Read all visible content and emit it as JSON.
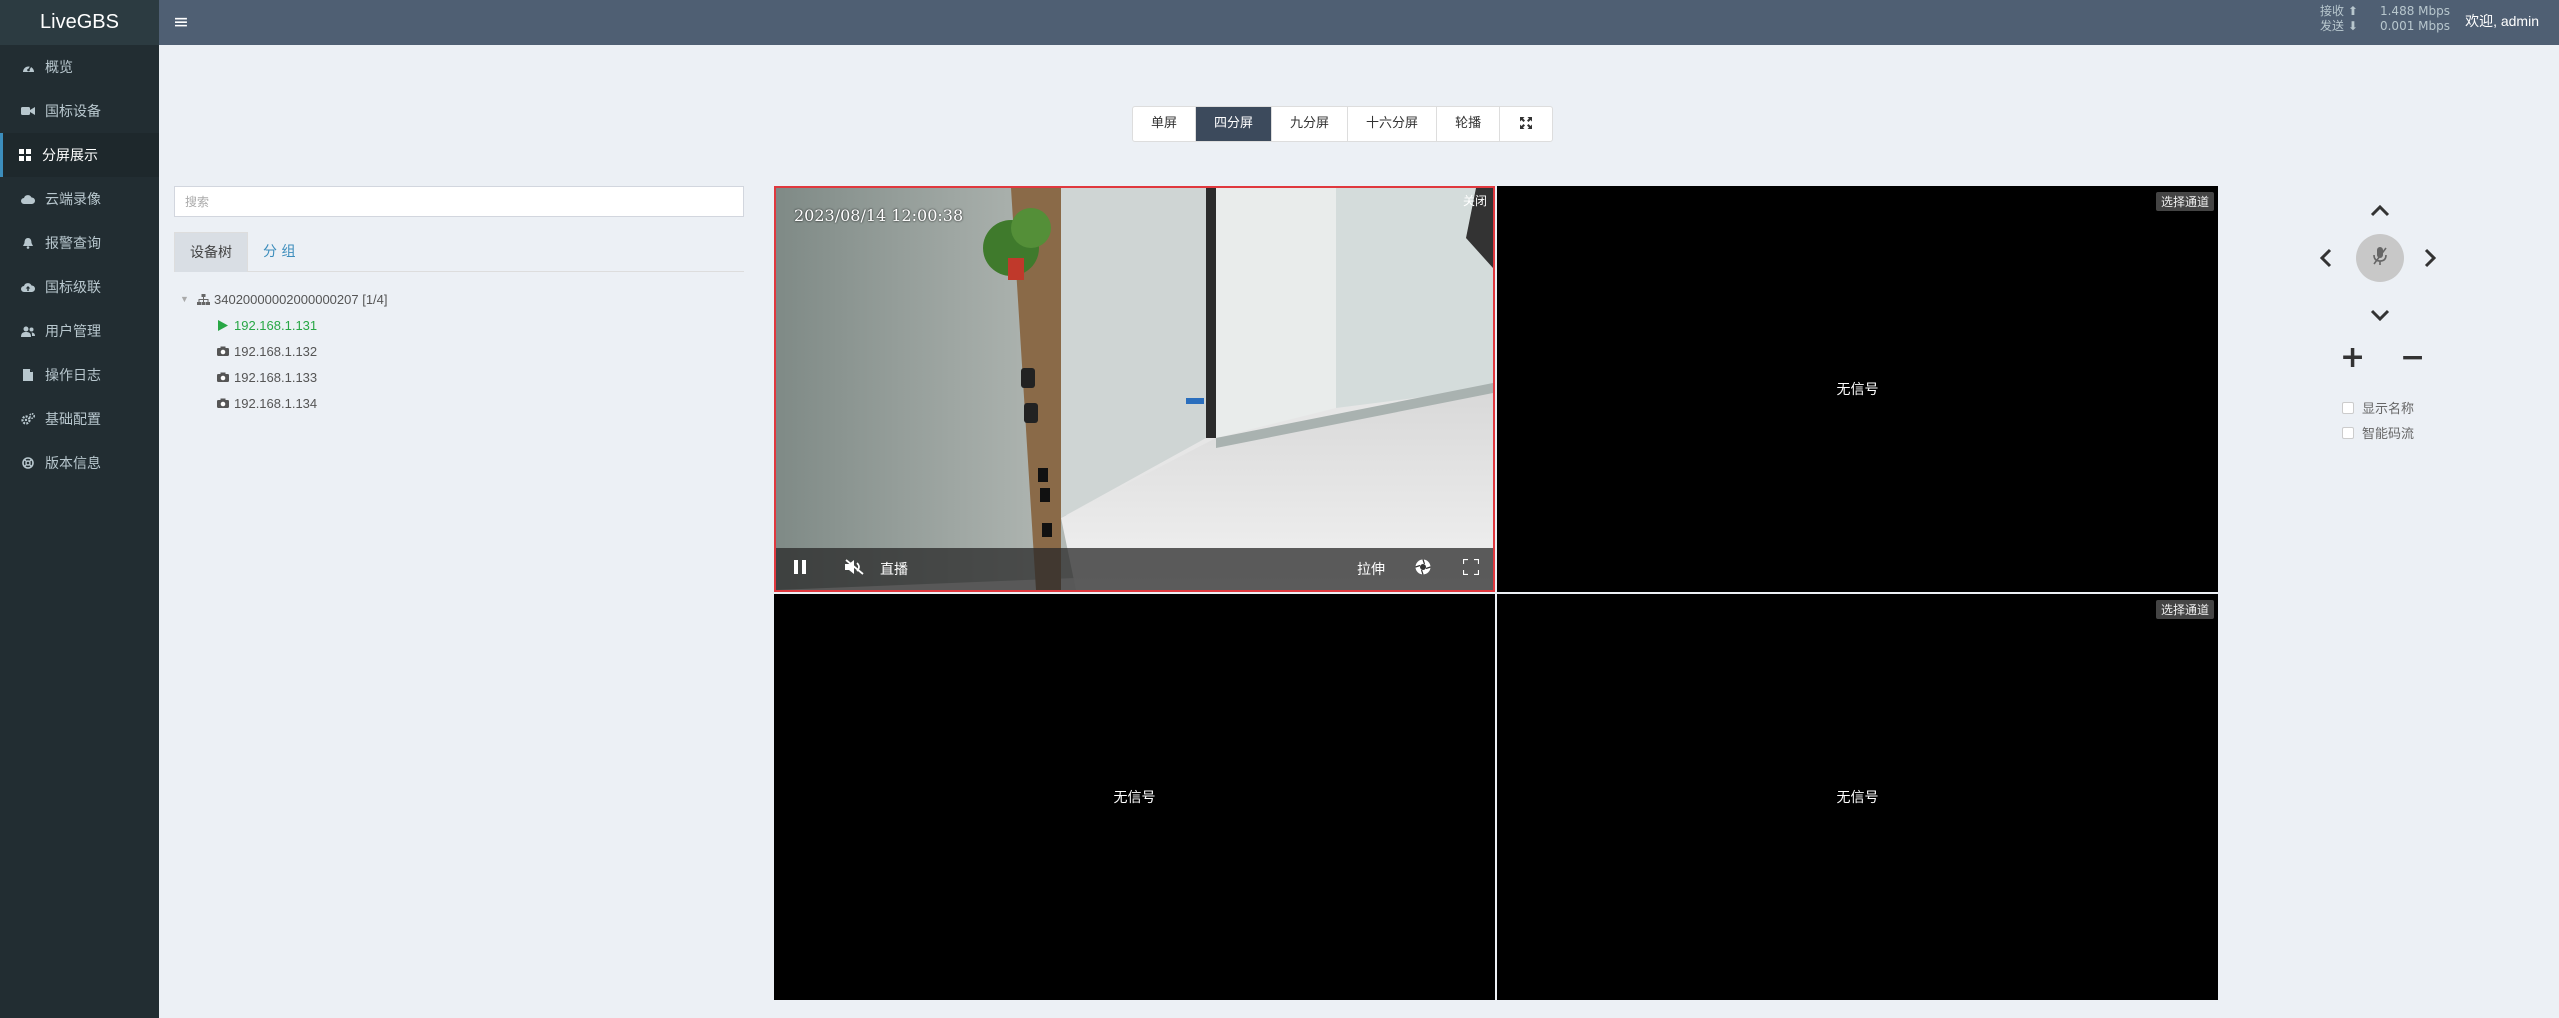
{
  "header": {
    "logo": "LiveGBS",
    "stats": {
      "recv_label": "接收 ⬆",
      "recv_value": "1.488 Mbps",
      "send_label": "发送 ⬇",
      "send_value": "0.001 Mbps"
    },
    "welcome": "欢迎, admin"
  },
  "sidebar": {
    "items": [
      {
        "label": "概览",
        "icon": "dashboard-icon"
      },
      {
        "label": "国标设备",
        "icon": "video-camera-icon"
      },
      {
        "label": "分屏展示",
        "icon": "grid-icon"
      },
      {
        "label": "云端录像",
        "icon": "cloud-icon"
      },
      {
        "label": "报警查询",
        "icon": "bell-icon"
      },
      {
        "label": "国标级联",
        "icon": "cloud-upload-icon"
      },
      {
        "label": "用户管理",
        "icon": "users-icon"
      },
      {
        "label": "操作日志",
        "icon": "file-icon"
      },
      {
        "label": "基础配置",
        "icon": "cogs-icon"
      },
      {
        "label": "版本信息",
        "icon": "info-icon"
      }
    ],
    "active_index": 2
  },
  "layout_tabs": {
    "items": [
      "单屏",
      "四分屏",
      "九分屏",
      "十六分屏",
      "轮播"
    ],
    "active": "四分屏",
    "fullscreen_icon": "expand-icon"
  },
  "left_panel": {
    "search_placeholder": "搜索",
    "tabs": [
      "设备树",
      "分 组"
    ],
    "tree": {
      "root": "34020000002000000207 [1/4]",
      "children": [
        {
          "label": "192.168.1.131",
          "status": "playing"
        },
        {
          "label": "192.168.1.132",
          "status": "idle"
        },
        {
          "label": "192.168.1.133",
          "status": "idle"
        },
        {
          "label": "192.168.1.134",
          "status": "idle"
        }
      ]
    }
  },
  "video_grid": {
    "cells": [
      {
        "state": "playing",
        "osd_time": "2023/08/14 12:00:38",
        "close_label": "关闭",
        "live_label": "直播",
        "stretch_label": "拉伸"
      },
      {
        "state": "empty",
        "no_signal": "无信号",
        "pick_label": "选择通道"
      },
      {
        "state": "empty",
        "no_signal": "无信号",
        "pick_label": ""
      },
      {
        "state": "empty",
        "no_signal": "无信号",
        "pick_label": "选择通道"
      }
    ]
  },
  "ptz": {
    "show_name": "显示名称",
    "smart_stream": "智能码流"
  }
}
